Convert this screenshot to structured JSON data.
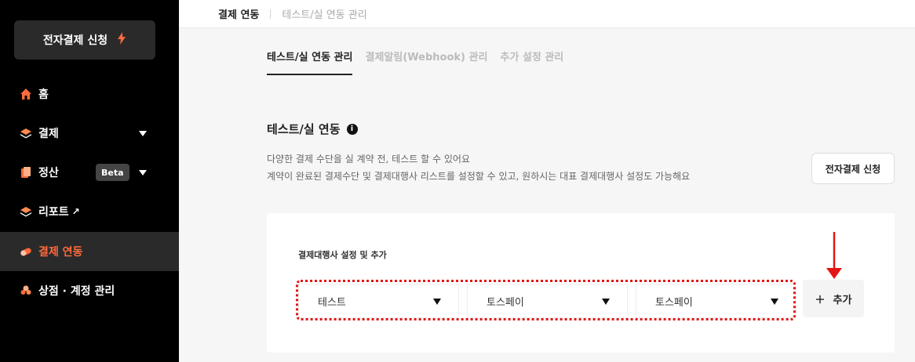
{
  "sidebar": {
    "apply_button": "전자결제 신청",
    "items": [
      {
        "label": "홈"
      },
      {
        "label": "결제"
      },
      {
        "label": "정산",
        "badge": "Beta"
      },
      {
        "label": "리포트"
      },
      {
        "label": "결제 연동"
      },
      {
        "label": "상점 · 계정 관리"
      }
    ]
  },
  "topbar": {
    "crumb_current": "결제 연동",
    "crumb_sub": "테스트/실 연동 관리"
  },
  "tabs": [
    "테스트/실 연동 관리",
    "결제알림(Webhook) 관리",
    "추가 설정 관리"
  ],
  "section": {
    "title": "테스트/실 연동",
    "desc1": "다양한 결제 수단을 실 계약 전, 테스트 할 수 있어요",
    "desc2": "계약이 완료된 결제수단 및 결제대행사 리스트를 설정할 수 있고, 원하시는 대표 결제대행사 설정도 가능해요",
    "apply_button": "전자결제 신청"
  },
  "card": {
    "label": "결제대행사 설정 및 추가",
    "dropdowns": [
      "테스트",
      "토스페이",
      "토스페이"
    ],
    "add_button": "추가"
  },
  "colors": {
    "accent": "#ff6a3d",
    "highlight": "#e41515",
    "sidebar_bg": "#000000"
  }
}
